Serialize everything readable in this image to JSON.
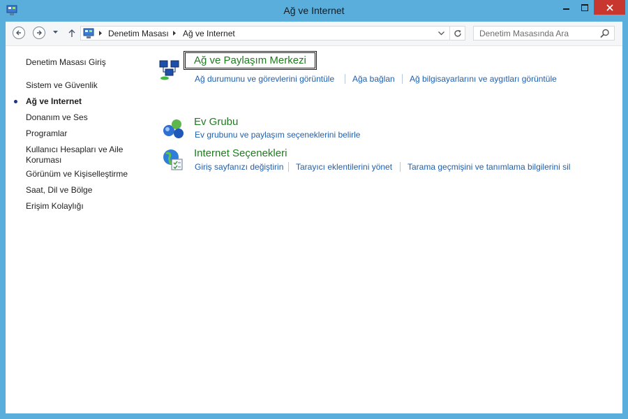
{
  "window": {
    "title": "Ağ ve Internet"
  },
  "nav": {
    "breadcrumb": [
      "Denetim Masası",
      "Ağ ve Internet"
    ],
    "search_placeholder": "Denetim Masasında Ara"
  },
  "sidebar": {
    "items": [
      {
        "label": "Denetim Masası Giriş"
      },
      {
        "label": "Sistem ve Güvenlik"
      },
      {
        "label": "Ağ ve Internet",
        "active": true
      },
      {
        "label": "Donanım ve Ses"
      },
      {
        "label": "Programlar"
      },
      {
        "label": "Kullanıcı Hesapları ve Aile Koruması"
      },
      {
        "label": "Görünüm ve Kişiselleştirme"
      },
      {
        "label": "Saat, Dil ve Bölge"
      },
      {
        "label": "Erişim Kolaylığı"
      }
    ]
  },
  "categories": [
    {
      "title": "Ağ ve Paylaşım Merkezi",
      "icon": "network-sharing-icon",
      "links": [
        "Ağ durumunu ve görevlerini görüntüle",
        "Ağa bağlan",
        "Ağ bilgisayarlarını ve aygıtları görüntüle"
      ]
    },
    {
      "title": "Ev Grubu",
      "icon": "homegroup-icon",
      "links": [
        "Ev grubunu ve paylaşım seçeneklerini belirle"
      ]
    },
    {
      "title": "Internet Seçenekleri",
      "icon": "internet-options-icon",
      "links": [
        "Giriş sayfanızı değiştirin",
        "Tarayıcı eklentilerini yönet",
        "Tarama geçmişini ve tanımlama bilgilerini sil"
      ]
    }
  ],
  "colors": {
    "frame": "#5aaedc",
    "close": "#c7372f",
    "link": "#1f5fb0",
    "category_title": "#1e7b1e"
  }
}
